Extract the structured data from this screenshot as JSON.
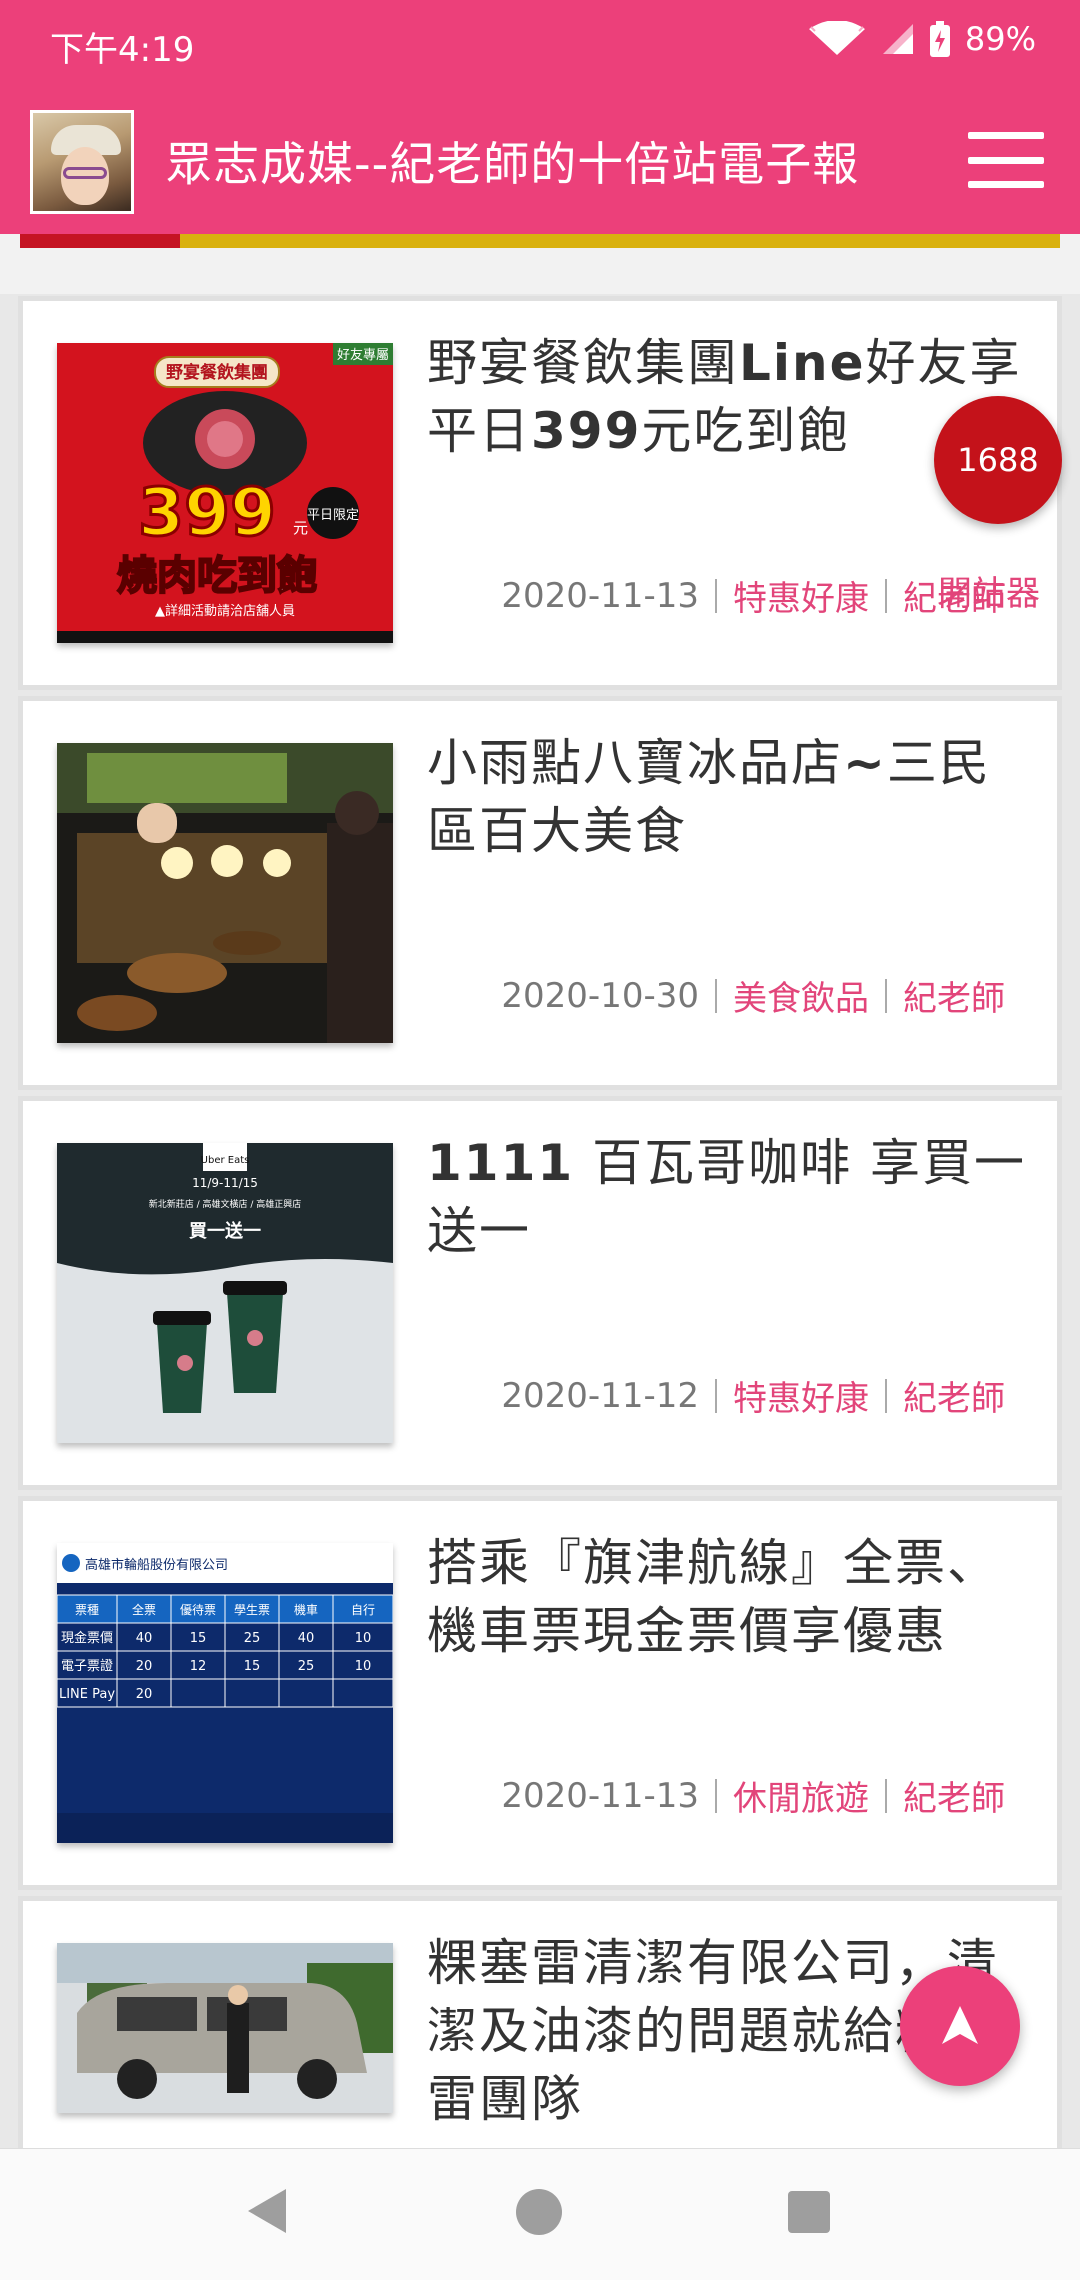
{
  "status_bar": {
    "time": "下午4:19",
    "battery": "89%"
  },
  "app_bar": {
    "title": "眾志成媒--紀老師的十倍站電子報"
  },
  "articles": [
    {
      "title_parts": [
        "野宴餐飲集團",
        "Line",
        "好友享平日",
        "399",
        "元吃到飽"
      ],
      "date": "2020-11-13",
      "category": "特惠好康",
      "author": "紀老師"
    },
    {
      "title_parts": [
        "小雨點八寶冰品店",
        "~",
        "三民區百大美食"
      ],
      "date": "2020-10-30",
      "category": "美食飲品",
      "author": "紀老師"
    },
    {
      "title_parts": [
        "1111",
        " 百瓦哥咖啡 享買一送一"
      ],
      "date": "2020-11-12",
      "category": "特惠好康",
      "author": "紀老師"
    },
    {
      "title": "搭乘『旗津航線』全票、機車票現金票價享優惠",
      "date": "2020-11-13",
      "category": "休閒旅遊",
      "author": "紀老師"
    },
    {
      "title": "粿塞雷清潔有限公司，清潔及油漆的問題就給粿塞雷團隊"
    }
  ],
  "thumbs": {
    "t1": {
      "banner": "野宴餐飲集團",
      "tag": "好友專屬",
      "price": "399",
      "unit": "元",
      "limit": "平日限定",
      "main": "燒肉吃到飽",
      "note": "▲詳細活動請洽店舖人員"
    },
    "t3": {
      "brand": "Uber Eats",
      "dates": "11/9-11/15",
      "shops": "新北新莊店 / 高雄文橫店 / 高雄正興店",
      "offer": "買一送一"
    },
    "t4": {
      "company": "高雄市輪船股份有限公司",
      "headers": [
        "票種",
        "全票",
        "優待票",
        "學生票",
        "機車",
        "自行"
      ],
      "rows": [
        [
          "現金票價",
          "40",
          "15",
          "25",
          "40",
          "10"
        ],
        [
          "電子票證",
          "20",
          "12",
          "15",
          "25",
          "10"
        ],
        [
          "LINE Pay",
          "20",
          "",
          "",
          "",
          ""
        ]
      ]
    }
  },
  "floating_badge": {
    "count": "1688",
    "label": "開站器"
  },
  "colors": {
    "primary": "#ec407a",
    "accent_text": "#e2457a",
    "badge": "#c4121a"
  },
  "icons": {
    "menu": "hamburger-menu-icon",
    "back_to_top": "arrow-up-icon",
    "nav_back": "triangle-back-icon",
    "nav_home": "circle-home-icon",
    "nav_recent": "square-recent-icon"
  }
}
